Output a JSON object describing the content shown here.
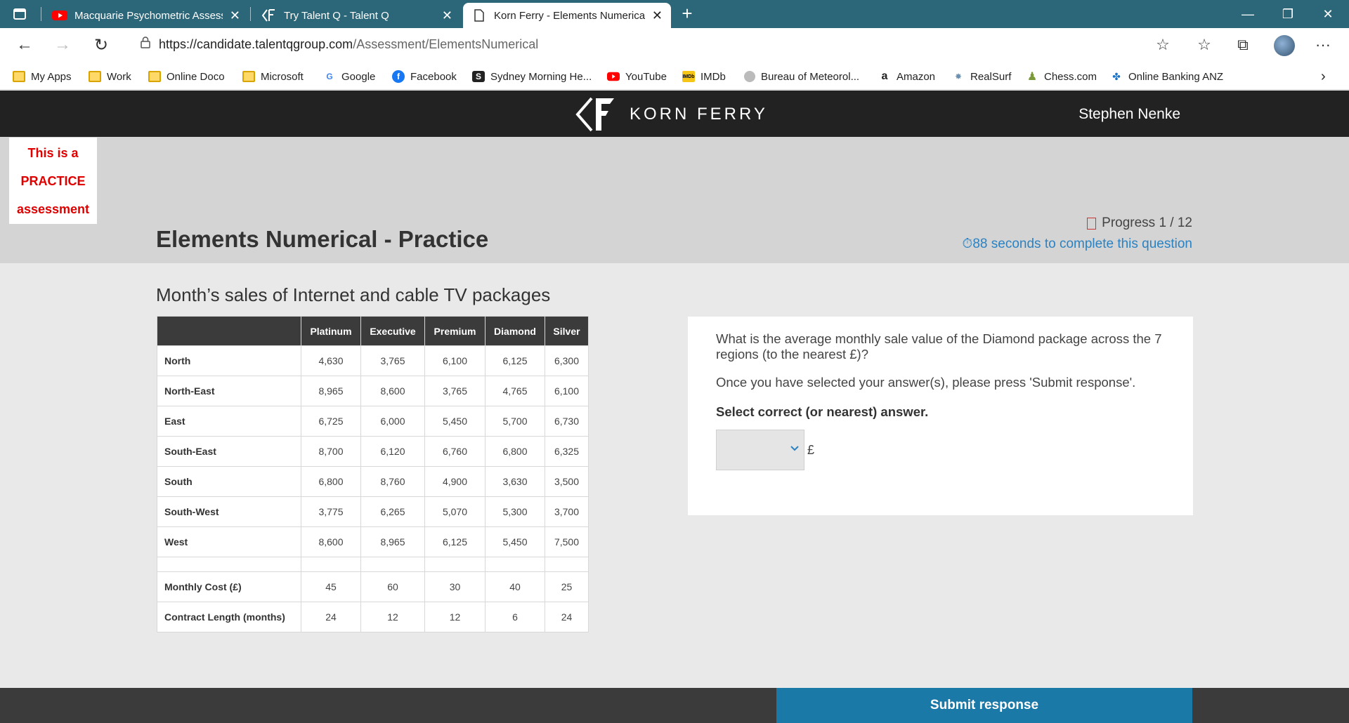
{
  "browser": {
    "tabs": [
      {
        "title": "Macquarie Psychometric Assessm",
        "favicon": "youtube-icon"
      },
      {
        "title": "Try Talent Q - Talent Q",
        "favicon": "kornferry-icon"
      },
      {
        "title": "Korn Ferry - Elements Numerical",
        "favicon": "page-icon"
      }
    ],
    "url_host": "https://candidate.talentqgroup.com",
    "url_path": "/Assessment/ElementsNumerical",
    "bookmarks": [
      "My Apps",
      "Work",
      "Online Doco",
      "Microsoft",
      "Google",
      "Facebook",
      "Sydney Morning He...",
      "YouTube",
      "IMDb",
      "Bureau of Meteorol...",
      "Amazon",
      "RealSurf",
      "Chess.com",
      "Online Banking  ANZ"
    ]
  },
  "header": {
    "brand": "KORN FERRY",
    "user": "Stephen Nenke"
  },
  "practice_notice": {
    "line1": "This is a",
    "line2": "PRACTICE",
    "line3": "assessment"
  },
  "page": {
    "title": "Elements Numerical - Practice",
    "progress": "Progress 1 / 12",
    "timer": "88 seconds to complete this question"
  },
  "table": {
    "title": "Month’s sales of Internet and cable TV packages",
    "columns": [
      "Platinum",
      "Executive",
      "Premium",
      "Diamond",
      "Silver"
    ],
    "rows": [
      {
        "label": "North",
        "values": [
          "4,630",
          "3,765",
          "6,100",
          "6,125",
          "6,300"
        ]
      },
      {
        "label": "North-East",
        "values": [
          "8,965",
          "8,600",
          "3,765",
          "4,765",
          "6,100"
        ]
      },
      {
        "label": "East",
        "values": [
          "6,725",
          "6,000",
          "5,450",
          "5,700",
          "6,730"
        ]
      },
      {
        "label": "South-East",
        "values": [
          "8,700",
          "6,120",
          "6,760",
          "6,800",
          "6,325"
        ]
      },
      {
        "label": "South",
        "values": [
          "6,800",
          "8,760",
          "4,900",
          "3,630",
          "3,500"
        ]
      },
      {
        "label": "South-West",
        "values": [
          "3,775",
          "6,265",
          "5,070",
          "5,300",
          "3,700"
        ]
      },
      {
        "label": "West",
        "values": [
          "8,600",
          "8,965",
          "6,125",
          "5,450",
          "7,500"
        ]
      }
    ],
    "extra_rows": [
      {
        "label": "Monthly Cost (£)",
        "values": [
          "45",
          "60",
          "30",
          "40",
          "25"
        ]
      },
      {
        "label": "Contract Length (months)",
        "values": [
          "24",
          "12",
          "12",
          "6",
          "24"
        ]
      }
    ]
  },
  "question": {
    "text": "What is the average monthly sale value of the Diamond package across the 7 regions (to the nearest £)?",
    "instruction": "Once you have selected your answer(s), please press 'Submit response'.",
    "select_label": "Select correct (or nearest) answer.",
    "currency": "£",
    "selected_value": ""
  },
  "footer": {
    "submit_label": "Submit response"
  }
}
